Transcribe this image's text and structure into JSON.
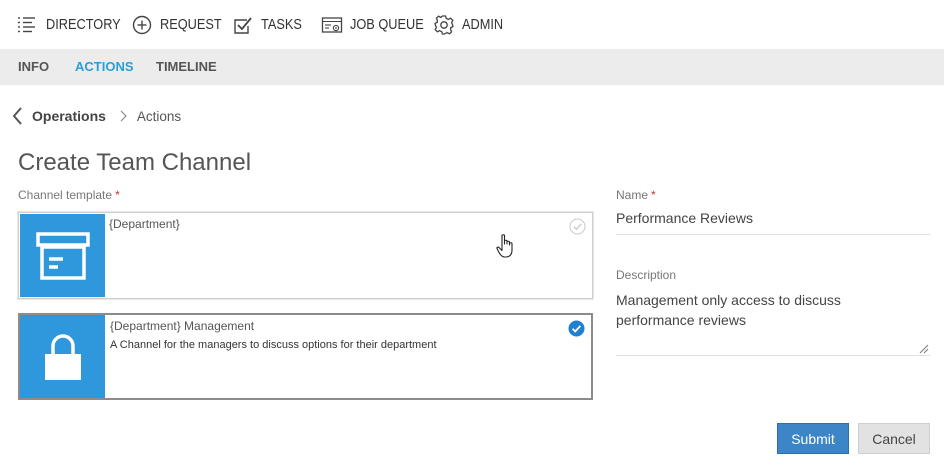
{
  "topnav": {
    "items": [
      {
        "label": "DIRECTORY",
        "icon": "directory-list-icon"
      },
      {
        "label": "REQUEST",
        "icon": "plus-circle-icon"
      },
      {
        "label": "TASKS",
        "icon": "checkbox-icon"
      },
      {
        "label": "JOB QUEUE",
        "icon": "job-queue-icon"
      },
      {
        "label": "ADMIN",
        "icon": "gear-icon"
      }
    ]
  },
  "tabs": [
    {
      "label": "INFO",
      "active": false
    },
    {
      "label": "ACTIONS",
      "active": true
    },
    {
      "label": "TIMELINE",
      "active": false
    }
  ],
  "breadcrumb": {
    "parent": "Operations",
    "current": "Actions"
  },
  "page": {
    "title": "Create Team Channel"
  },
  "form": {
    "template_label": "Channel template",
    "required_marker": "*",
    "templates": [
      {
        "title": "{Department}",
        "description": "",
        "icon": "archive-box-icon",
        "selected": false
      },
      {
        "title": "{Department} Management",
        "description": "A Channel for the managers to discuss options for their department",
        "icon": "lock-icon",
        "selected": true
      }
    ],
    "name_label": "Name",
    "name_value": "Performance Reviews",
    "description_label": "Description",
    "description_value": "Management only access to discuss performance reviews",
    "submit_label": "Submit",
    "cancel_label": "Cancel"
  },
  "colors": {
    "accent": "#2a9fd6",
    "thumb_blue": "#2f97dc",
    "submit_blue": "#3c86c7",
    "tabbar_bg": "#ececec",
    "required_red": "#c0392b"
  }
}
